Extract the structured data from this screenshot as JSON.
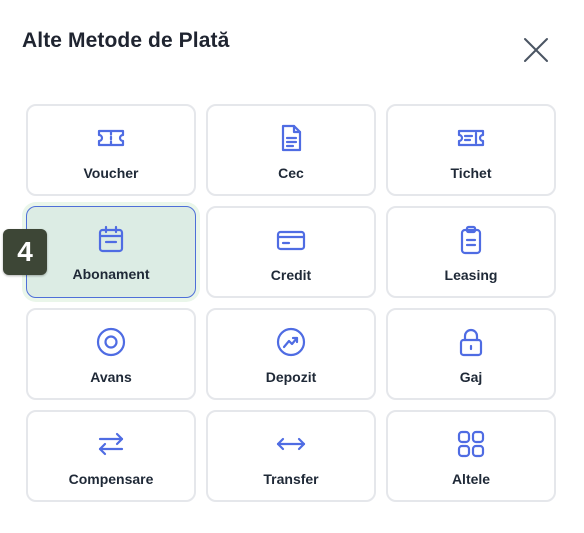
{
  "dialog": {
    "title": "Alte Metode de Plată",
    "close_icon": "close-icon"
  },
  "accent_color": "#4f6ce3",
  "selected_tile_bg": "#dcece4",
  "badge": {
    "text": "4"
  },
  "tiles": [
    {
      "label": "Voucher",
      "icon": "ticket-icon"
    },
    {
      "label": "Cec",
      "icon": "document-icon"
    },
    {
      "label": "Tichet",
      "icon": "ticket-list-icon"
    },
    {
      "label": "Abonament",
      "icon": "calendar-icon",
      "selected": true
    },
    {
      "label": "Credit",
      "icon": "credit-card-icon"
    },
    {
      "label": "Leasing",
      "icon": "clipboard-icon"
    },
    {
      "label": "Avans",
      "icon": "target-icon"
    },
    {
      "label": "Depozit",
      "icon": "trending-up-icon"
    },
    {
      "label": "Gaj",
      "icon": "lock-icon"
    },
    {
      "label": "Compensare",
      "icon": "swap-arrows-icon"
    },
    {
      "label": "Transfer",
      "icon": "double-arrow-icon"
    },
    {
      "label": "Altele",
      "icon": "grid-icon"
    }
  ]
}
